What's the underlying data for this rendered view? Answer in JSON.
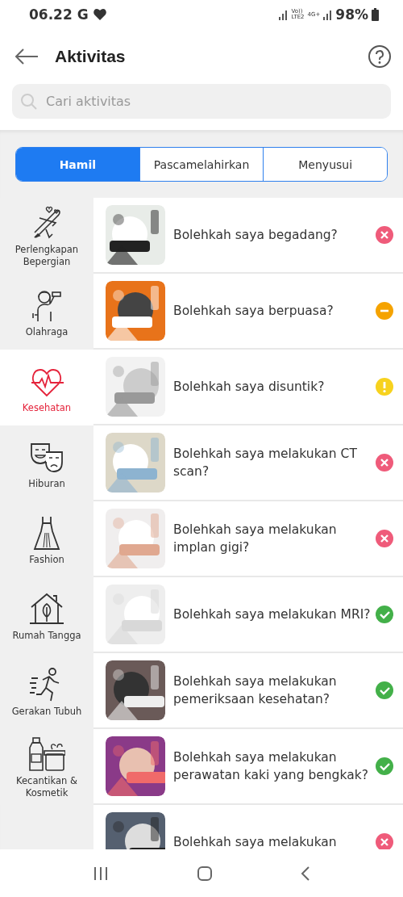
{
  "status_bar": {
    "time": "06.22",
    "carrier": "G",
    "volte": "Vo))",
    "lte": "LTE2",
    "network": "4G+",
    "battery": "98%"
  },
  "header": {
    "title": "Aktivitas"
  },
  "search": {
    "placeholder": "Cari aktivitas"
  },
  "tabs": [
    {
      "label": "Hamil",
      "selected": true
    },
    {
      "label": "Pascamelahirkan",
      "selected": false
    },
    {
      "label": "Menyusui",
      "selected": false
    }
  ],
  "sidebar": {
    "items": [
      {
        "label": "Perlengkapan Bepergian",
        "selected": false
      },
      {
        "label": "Olahraga",
        "selected": false
      },
      {
        "label": "Kesehatan",
        "selected": true
      },
      {
        "label": "Hiburan",
        "selected": false
      },
      {
        "label": "Fashion",
        "selected": false
      },
      {
        "label": "Rumah Tangga",
        "selected": false
      },
      {
        "label": "Gerakan Tubuh",
        "selected": false
      },
      {
        "label": "Kecantikan & Kosmetik",
        "selected": false
      }
    ]
  },
  "activities": [
    {
      "question": "Bolehkah saya begadang?",
      "kind": "no"
    },
    {
      "question": "Bolehkah saya berpuasa?",
      "kind": "limited"
    },
    {
      "question": "Bolehkah saya disuntik?",
      "kind": "caution"
    },
    {
      "question": "Bolehkah saya melakukan CT scan?",
      "kind": "no"
    },
    {
      "question": "Bolehkah saya melakukan implan gigi?",
      "kind": "no"
    },
    {
      "question": "Bolehkah saya melakukan MRI?",
      "kind": "yes"
    },
    {
      "question": "Bolehkah saya melakukan pemeriksaan kesehatan?",
      "kind": "yes"
    },
    {
      "question": "Bolehkah saya melakukan perawatan kaki yang bengkak?",
      "kind": "yes"
    },
    {
      "question": "Bolehkah saya melakukan",
      "kind": "no"
    }
  ]
}
